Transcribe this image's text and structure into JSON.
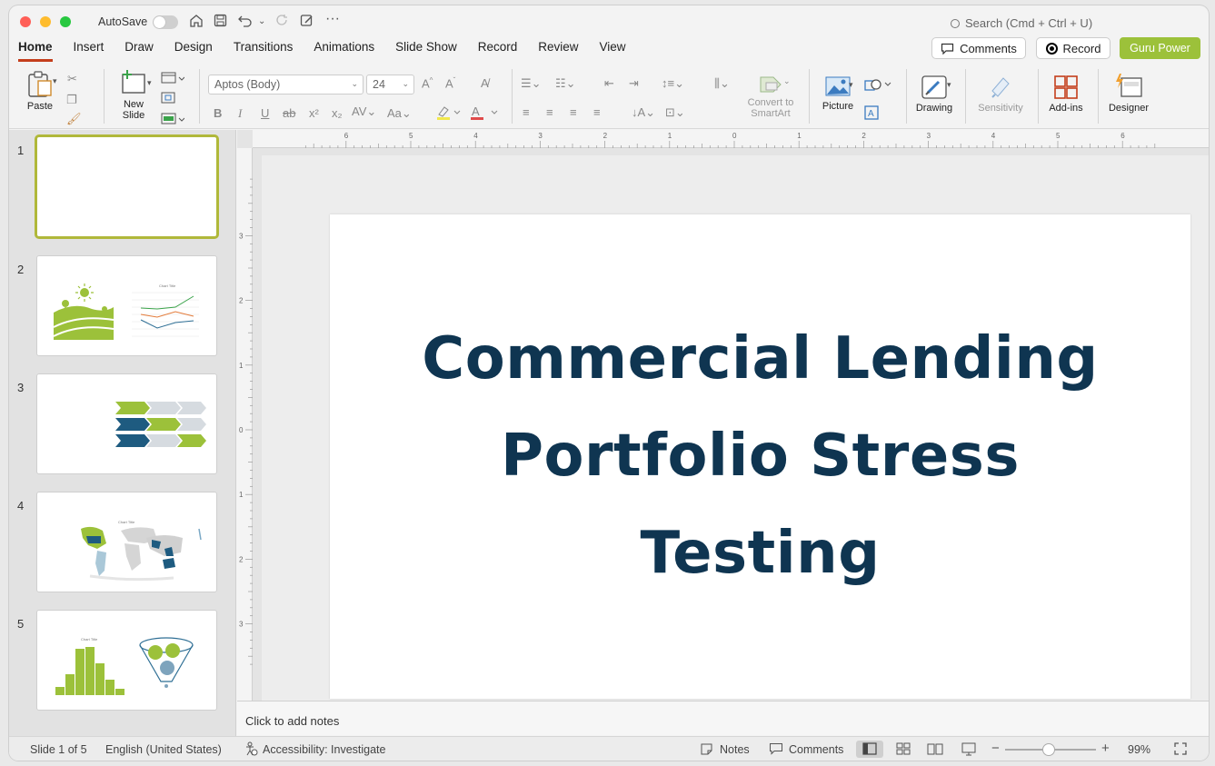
{
  "titlebar": {
    "autosave_label": "AutoSave",
    "search_placeholder": "Search (Cmd + Ctrl + U)"
  },
  "menu": {
    "tabs": [
      "Home",
      "Insert",
      "Draw",
      "Design",
      "Transitions",
      "Animations",
      "Slide Show",
      "Record",
      "Review",
      "View"
    ],
    "active_tab": "Home",
    "comments_label": "Comments",
    "record_label": "Record",
    "guru_label": "Guru Power"
  },
  "ribbon": {
    "paste": "Paste",
    "new_slide_line1": "New",
    "new_slide_line2": "Slide",
    "font_name": "Aptos (Body)",
    "font_size": "24",
    "convert_line1": "Convert to",
    "convert_line2": "SmartArt",
    "picture": "Picture",
    "drawing": "Drawing",
    "sensitivity": "Sensitivity",
    "addins": "Add-ins",
    "designer": "Designer"
  },
  "thumbnails": {
    "numbers": [
      "1",
      "2",
      "3",
      "4",
      "5"
    ],
    "slide2_chart_title": "Chart Title",
    "slide4_chart_title": "Chart Title",
    "slide5_chart_title": "Chart Title"
  },
  "slide": {
    "title_line1": "Commercial Lending",
    "title_line2": "Portfolio Stress",
    "title_line3": "Testing"
  },
  "notes": {
    "placeholder": "Click to add notes"
  },
  "statusbar": {
    "slide_info": "Slide 1 of 5",
    "language": "English (United States)",
    "accessibility": "Accessibility: Investigate",
    "notes": "Notes",
    "comments": "Comments",
    "zoom": "99%"
  },
  "colors": {
    "accent_green": "#9cc13a",
    "title_navy": "#0f3551",
    "tab_underline": "#c43e1c"
  }
}
